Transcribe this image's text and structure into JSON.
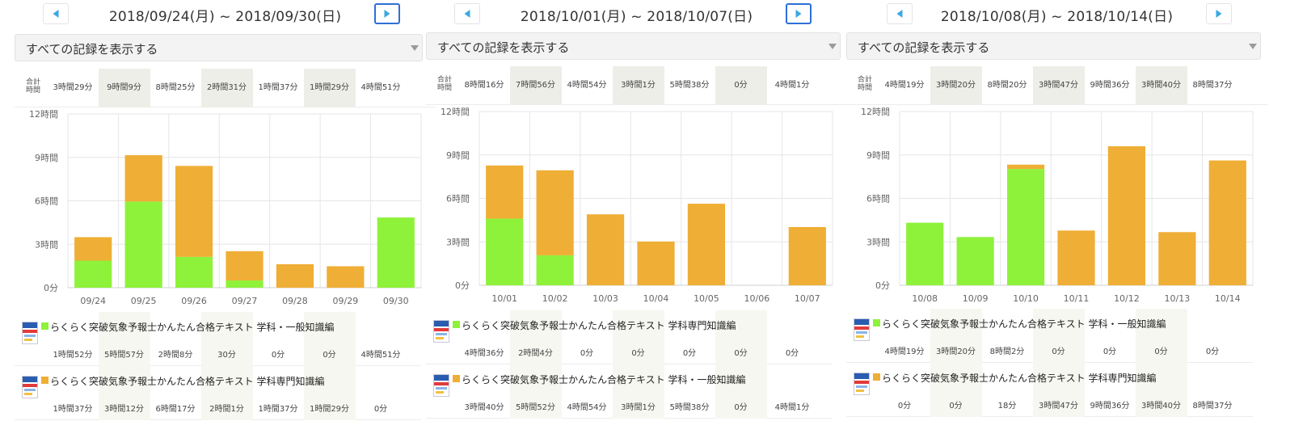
{
  "colors": {
    "green": "#8ef23a",
    "orange": "#efae35",
    "grid": "#e6e6e6",
    "axis": "#cfcfcf",
    "label": "#666666"
  },
  "icons": {
    "prev": "triangle-left-icon",
    "next": "triangle-right-icon",
    "dropdown": "caret-down-icon",
    "book": "book-cover-icon"
  },
  "weeks": [
    {
      "title": "2018/09/24(月) ~ 2018/09/30(日)",
      "filter": "すべての記録を表示する",
      "totals_label": "合計時間",
      "totals": [
        "3時間29分",
        "9時間9分",
        "8時間25分",
        "2時間31分",
        "1時間37分",
        "1時間29分",
        "4時間51分"
      ],
      "chart_data": {
        "type": "bar",
        "categories": [
          "09/24",
          "09/25",
          "09/26",
          "09/27",
          "09/28",
          "09/29",
          "09/30"
        ],
        "series": [
          {
            "values": [
              1.87,
              5.95,
              2.13,
              0.5,
              0,
              0,
              4.85
            ]
          },
          {
            "values": [
              1.62,
              3.2,
              6.28,
              2.02,
              1.62,
              1.48,
              0
            ]
          }
        ],
        "yticks": [
          "0分",
          "3時間",
          "6時間",
          "9時間",
          "12時間"
        ],
        "ylim": [
          0,
          12
        ]
      },
      "books": [
        {
          "title": "らくらく突破気象予報士かんたん合格テキスト 学科・一般知識編",
          "color": "green",
          "values": [
            "1時間52分",
            "5時間57分",
            "2時間8分",
            "30分",
            "0分",
            "0分",
            "4時間51分"
          ]
        },
        {
          "title": "らくらく突破気象予報士かんたん合格テキスト 学科専門知識編",
          "color": "orange",
          "values": [
            "1時間37分",
            "3時間12分",
            "6時間17分",
            "2時間1分",
            "1時間37分",
            "1時間29分",
            "0分"
          ]
        }
      ]
    },
    {
      "title": "2018/10/01(月) ~ 2018/10/07(日)",
      "filter": "すべての記録を表示する",
      "totals_label": "合計時間",
      "totals": [
        "8時間16分",
        "7時間56分",
        "4時間54分",
        "3時間1分",
        "5時間38分",
        "0分",
        "4時間1分"
      ],
      "chart_data": {
        "type": "bar",
        "categories": [
          "10/01",
          "10/02",
          "10/03",
          "10/04",
          "10/05",
          "10/06",
          "10/07"
        ],
        "series": [
          {
            "values": [
              4.6,
              2.07,
              0,
              0,
              0,
              0,
              0
            ]
          },
          {
            "values": [
              3.67,
              5.87,
              4.9,
              3.02,
              5.63,
              0,
              4.02
            ]
          }
        ],
        "yticks": [
          "0分",
          "3時間",
          "6時間",
          "9時間",
          "12時間"
        ],
        "ylim": [
          0,
          12
        ]
      },
      "books": [
        {
          "title": "らくらく突破気象予報士かんたん合格テキスト 学科専門知識編",
          "color": "green",
          "values": [
            "4時間36分",
            "2時間4分",
            "0分",
            "0分",
            "0分",
            "0分",
            "0分"
          ]
        },
        {
          "title": "らくらく突破気象予報士かんたん合格テキスト 学科・一般知識編",
          "color": "orange",
          "values": [
            "3時間40分",
            "5時間52分",
            "4時間54分",
            "3時間1分",
            "5時間38分",
            "0分",
            "4時間1分"
          ]
        }
      ]
    },
    {
      "title": "2018/10/08(月) ~ 2018/10/14(日)",
      "filter": "すべての記録を表示する",
      "totals_label": "合計時間",
      "totals": [
        "4時間19分",
        "3時間20分",
        "8時間20分",
        "3時間47分",
        "9時間36分",
        "3時間40分",
        "8時間37分"
      ],
      "chart_data": {
        "type": "bar",
        "categories": [
          "10/08",
          "10/09",
          "10/10",
          "10/11",
          "10/12",
          "10/13",
          "10/14"
        ],
        "series": [
          {
            "values": [
              4.32,
              3.33,
              8.03,
              0,
              0,
              0,
              0
            ]
          },
          {
            "values": [
              0,
              0,
              0.3,
              3.78,
              9.6,
              3.67,
              8.62
            ]
          }
        ],
        "yticks": [
          "0分",
          "3時間",
          "6時間",
          "9時間",
          "12時間"
        ],
        "ylim": [
          0,
          12
        ]
      },
      "books": [
        {
          "title": "らくらく突破気象予報士かんたん合格テキスト 学科・一般知識編",
          "color": "green",
          "values": [
            "4時間19分",
            "3時間20分",
            "8時間2分",
            "0分",
            "0分",
            "0分",
            "0分"
          ]
        },
        {
          "title": "らくらく突破気象予報士かんたん合格テキスト 学科専門知識編",
          "color": "orange",
          "values": [
            "0分",
            "0分",
            "18分",
            "3時間47分",
            "9時間36分",
            "3時間40分",
            "8時間37分"
          ]
        }
      ]
    }
  ]
}
